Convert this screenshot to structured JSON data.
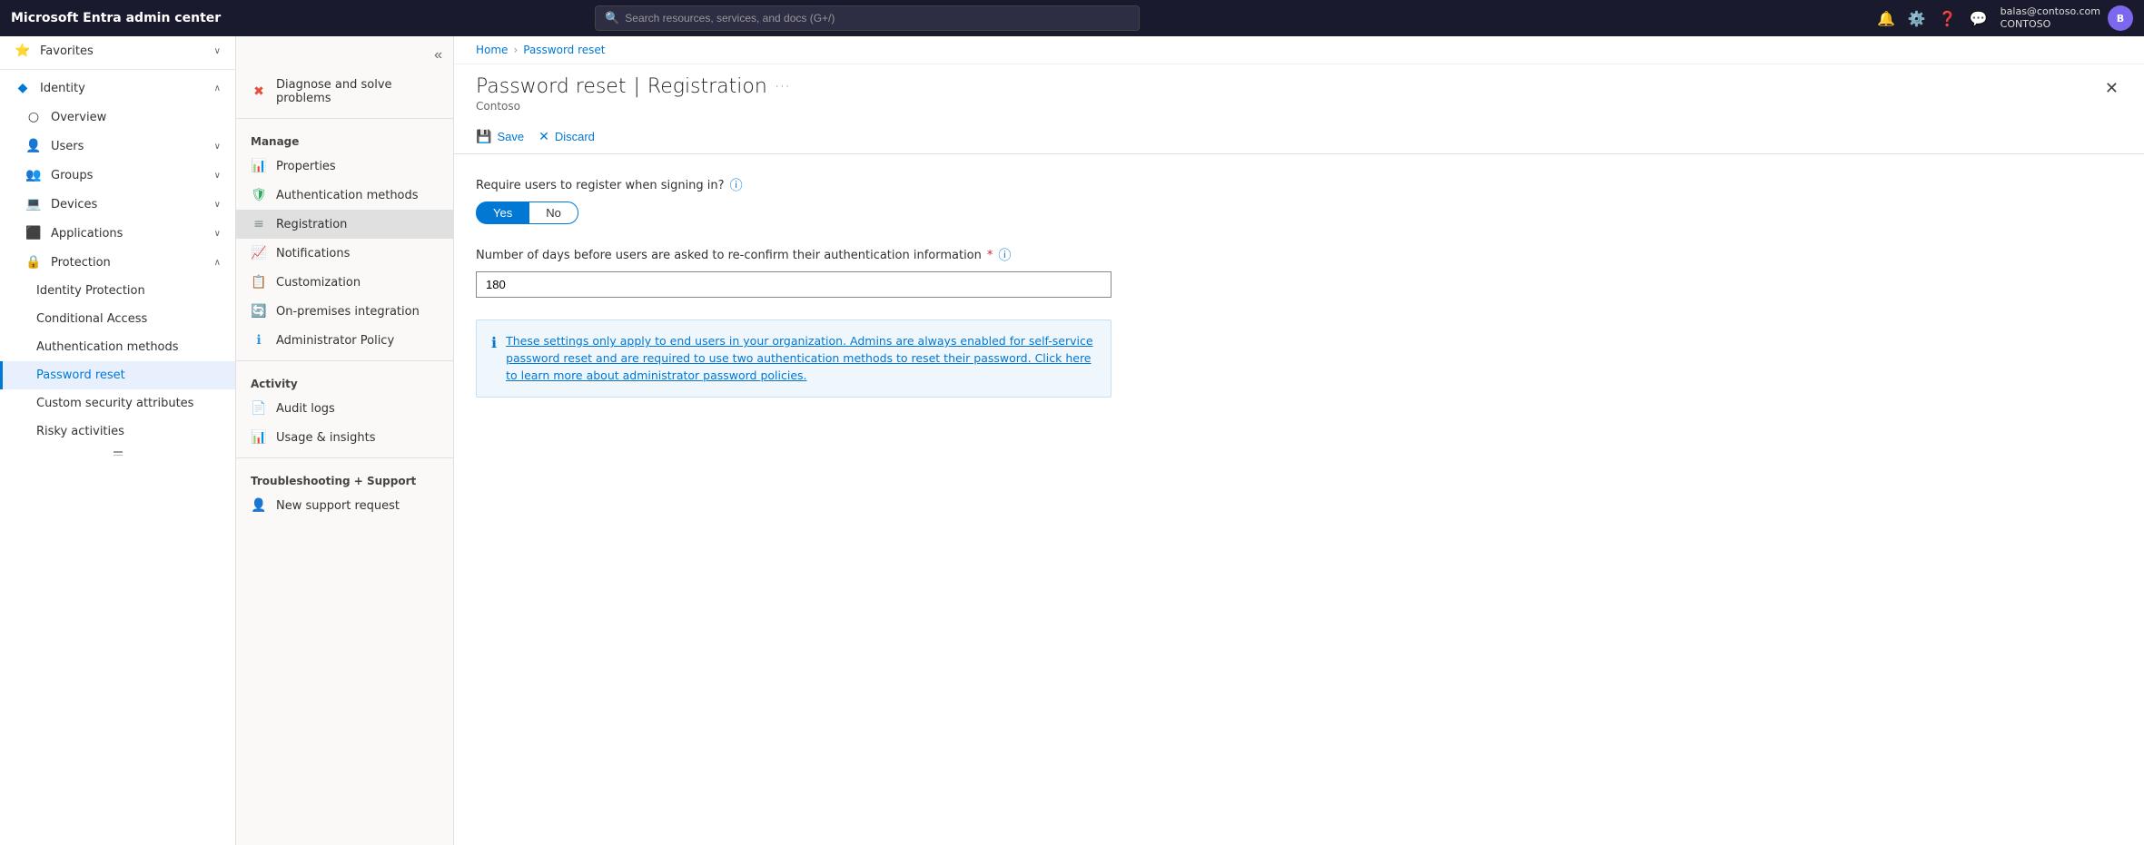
{
  "topbar": {
    "brand": "Microsoft Entra admin center",
    "search_placeholder": "Search resources, services, and docs (G+/)",
    "user_name": "balas@contoso.com",
    "user_org": "CONTOSO",
    "user_initials": "B"
  },
  "sidebar": {
    "favorites_label": "Favorites",
    "items": [
      {
        "id": "identity",
        "label": "Identity",
        "icon": "🔷",
        "has_chevron": true,
        "expanded": true
      },
      {
        "id": "overview",
        "label": "Overview",
        "icon": "○",
        "indent": 1
      },
      {
        "id": "users",
        "label": "Users",
        "icon": "👤",
        "indent": 1,
        "has_chevron": true
      },
      {
        "id": "groups",
        "label": "Groups",
        "icon": "👥",
        "indent": 1,
        "has_chevron": true
      },
      {
        "id": "devices",
        "label": "Devices",
        "icon": "💻",
        "indent": 1,
        "has_chevron": true
      },
      {
        "id": "applications",
        "label": "Applications",
        "icon": "⬛",
        "indent": 1,
        "has_chevron": true
      },
      {
        "id": "protection",
        "label": "Protection",
        "icon": "🔒",
        "indent": 1,
        "has_chevron": true,
        "expanded": true
      },
      {
        "id": "identity-protection",
        "label": "Identity Protection",
        "indent": 2
      },
      {
        "id": "conditional-access",
        "label": "Conditional Access",
        "indent": 2
      },
      {
        "id": "auth-methods",
        "label": "Authentication methods",
        "indent": 2
      },
      {
        "id": "password-reset",
        "label": "Password reset",
        "indent": 2,
        "active": true
      },
      {
        "id": "custom-security",
        "label": "Custom security attributes",
        "indent": 2
      },
      {
        "id": "risky-activities",
        "label": "Risky activities",
        "indent": 2
      }
    ]
  },
  "inner_nav": {
    "collapse_title": "Collapse",
    "diagnose_label": "Diagnose and solve problems",
    "manage_section": "Manage",
    "manage_items": [
      {
        "id": "properties",
        "label": "Properties",
        "icon": "📊"
      },
      {
        "id": "auth-methods",
        "label": "Authentication methods",
        "icon": "🛡"
      },
      {
        "id": "registration",
        "label": "Registration",
        "icon": "≡",
        "active": true
      },
      {
        "id": "notifications",
        "label": "Notifications",
        "icon": "📈"
      },
      {
        "id": "customization",
        "label": "Customization",
        "icon": "📋"
      },
      {
        "id": "on-premises",
        "label": "On-premises integration",
        "icon": "🔄"
      },
      {
        "id": "admin-policy",
        "label": "Administrator Policy",
        "icon": "ℹ"
      }
    ],
    "activity_section": "Activity",
    "activity_items": [
      {
        "id": "audit-logs",
        "label": "Audit logs",
        "icon": "📄"
      },
      {
        "id": "usage-insights",
        "label": "Usage & insights",
        "icon": "📊"
      }
    ],
    "troubleshooting_section": "Troubleshooting + Support",
    "troubleshooting_items": [
      {
        "id": "new-support",
        "label": "New support request",
        "icon": "👤"
      }
    ]
  },
  "breadcrumb": {
    "home": "Home",
    "current": "Password reset"
  },
  "page": {
    "title_main": "Password reset",
    "title_separator": "|",
    "title_sub": "Registration",
    "subtitle": "Contoso",
    "ellipsis": "···",
    "close_icon": "✕"
  },
  "toolbar": {
    "save_label": "Save",
    "discard_label": "Discard",
    "save_icon": "💾",
    "discard_icon": "✕"
  },
  "form": {
    "register_question": "Require users to register when signing in?",
    "register_yes": "Yes",
    "register_no": "No",
    "days_label": "Number of days before users are asked to re-confirm their authentication information",
    "days_value": "180",
    "info_text": "These settings only apply to end users in your organization. Admins are always enabled for self-service password reset and are required to use two authentication methods to reset their password. Click here to learn more about administrator password policies."
  }
}
